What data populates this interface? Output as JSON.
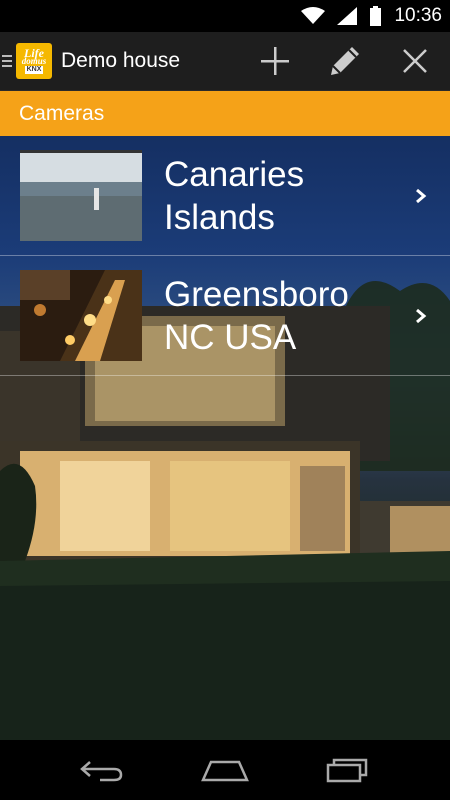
{
  "status_bar": {
    "time": "10:36",
    "icons": [
      "wifi-icon",
      "signal-icon",
      "battery-icon"
    ]
  },
  "action_bar": {
    "title": "Demo house",
    "logo": {
      "line1": "My",
      "line2": "Life",
      "line3": "domus",
      "line4": "KNX"
    },
    "actions": [
      "add-icon",
      "edit-pencil-icon",
      "close-icon"
    ]
  },
  "section": {
    "title": "Cameras"
  },
  "cameras": [
    {
      "name_line1": "Canaries",
      "name_line2": "Islands"
    },
    {
      "name_line1": "Greensboro",
      "name_line2": "NC USA"
    }
  ],
  "nav_bar": {
    "buttons": [
      "back-icon",
      "home-icon",
      "recent-apps-icon"
    ]
  },
  "colors": {
    "accent": "#f5a218",
    "action_bar": "#1e1e1e",
    "logo": "#f5b800"
  }
}
